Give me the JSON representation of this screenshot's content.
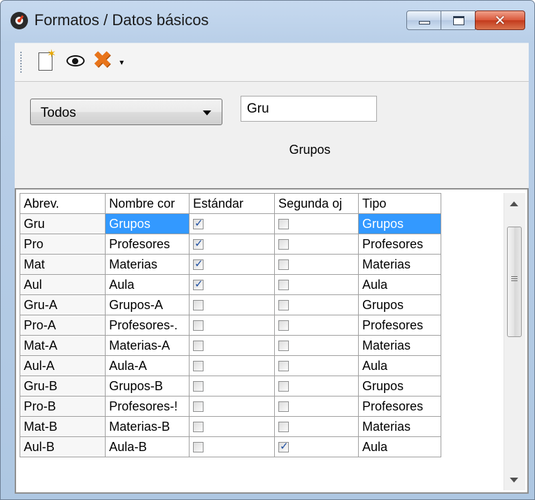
{
  "window": {
    "title": "Formatos / Datos básicos"
  },
  "titlebar_buttons": {
    "minimize_icon": "minimize-icon",
    "maximize_icon": "maximize-icon",
    "close_icon": "close-icon",
    "close_glyph": "✕"
  },
  "toolbar": {
    "new_icon": "new-document-icon",
    "view_icon": "eye-icon",
    "delete_icon": "delete-x-icon",
    "delete_glyph": "✖",
    "dropdown_glyph": "▾"
  },
  "filter": {
    "combo_value": "Todos",
    "search_value": "Gru",
    "caption": "Grupos"
  },
  "grid": {
    "columns": [
      "Abrev.",
      "Nombre cor",
      "Estándar",
      "Segunda oj",
      "Tipo"
    ],
    "selected_row": 0,
    "rows": [
      {
        "abrev": "Gru",
        "nombre": "Grupos",
        "estandar": true,
        "segunda": false,
        "tipo": "Grupos"
      },
      {
        "abrev": "Pro",
        "nombre": "Profesores",
        "estandar": true,
        "segunda": false,
        "tipo": "Profesores"
      },
      {
        "abrev": "Mat",
        "nombre": "Materias",
        "estandar": true,
        "segunda": false,
        "tipo": "Materias"
      },
      {
        "abrev": "Aul",
        "nombre": "Aula",
        "estandar": true,
        "segunda": false,
        "tipo": "Aula"
      },
      {
        "abrev": "Gru-A",
        "nombre": "Grupos-A",
        "estandar": false,
        "segunda": false,
        "tipo": "Grupos"
      },
      {
        "abrev": "Pro-A",
        "nombre": "Profesores-.",
        "estandar": false,
        "segunda": false,
        "tipo": "Profesores"
      },
      {
        "abrev": "Mat-A",
        "nombre": "Materias-A",
        "estandar": false,
        "segunda": false,
        "tipo": "Materias"
      },
      {
        "abrev": "Aul-A",
        "nombre": "Aula-A",
        "estandar": false,
        "segunda": false,
        "tipo": "Aula"
      },
      {
        "abrev": "Gru-B",
        "nombre": "Grupos-B",
        "estandar": false,
        "segunda": false,
        "tipo": "Grupos"
      },
      {
        "abrev": "Pro-B",
        "nombre": "Profesores-!",
        "estandar": false,
        "segunda": false,
        "tipo": "Profesores"
      },
      {
        "abrev": "Mat-B",
        "nombre": "Materias-B",
        "estandar": false,
        "segunda": false,
        "tipo": "Materias"
      },
      {
        "abrev": "Aul-B",
        "nombre": "Aula-B",
        "estandar": false,
        "segunda": true,
        "tipo": "Aula"
      }
    ]
  },
  "scrollbar": {
    "up_icon": "scroll-up-arrow-icon",
    "down_icon": "scroll-down-arrow-icon",
    "thumb_position": 0
  }
}
